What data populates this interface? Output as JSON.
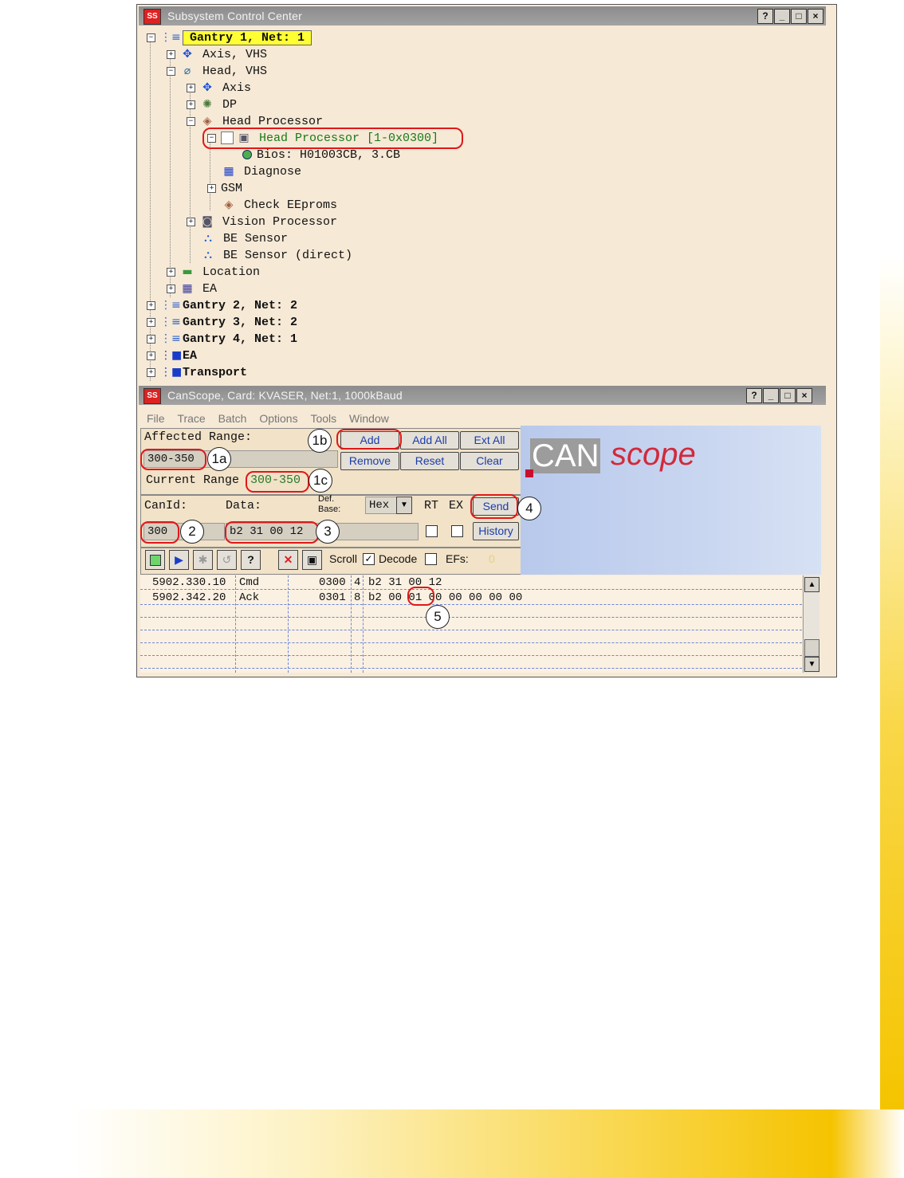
{
  "scc": {
    "title": "Subsystem Control Center",
    "tree": [
      {
        "label": "Gantry 1, Net: 1"
      },
      {
        "label": "Axis, VHS"
      },
      {
        "label": "Head, VHS"
      },
      {
        "label": "Axis"
      },
      {
        "label": "DP"
      },
      {
        "label": "Head Processor"
      },
      {
        "label": "Head Processor [1-0x0300]"
      },
      {
        "label": "Bios: H01003CB, 3.CB"
      },
      {
        "label": "Diagnose"
      },
      {
        "label": "GSM"
      },
      {
        "label": "Check EEproms"
      },
      {
        "label": "Vision Processor"
      },
      {
        "label": "BE Sensor"
      },
      {
        "label": "BE Sensor (direct)"
      },
      {
        "label": "Location"
      },
      {
        "label": "EA"
      },
      {
        "label": "Gantry 2, Net: 2"
      },
      {
        "label": "Gantry 3, Net: 2"
      },
      {
        "label": "Gantry 4, Net: 1"
      },
      {
        "label": "EA"
      },
      {
        "label": "Transport"
      }
    ]
  },
  "canscope": {
    "title": "CanScope, Card: KVASER, Net:1, 1000kBaud",
    "menu": [
      "File",
      "Trace",
      "Batch",
      "Options",
      "Tools",
      "Window"
    ],
    "affected_range_label": "Affected Range:",
    "affected_range_value": "300-350",
    "current_range_label": "Current Range",
    "current_range_value": "300-350",
    "buttons": {
      "add": "Add",
      "add_all": "Add All",
      "ext_all": "Ext All",
      "remove": "Remove",
      "reset": "Reset",
      "clear": "Clear",
      "send": "Send",
      "history": "History"
    },
    "canid_label": "CanId:",
    "data_label": "Data:",
    "def_base_label_1": "Def.",
    "def_base_label_2": "Base:",
    "base_value": "Hex",
    "rt_label": "RT",
    "ex_label": "EX",
    "canid_value": "300",
    "data_value": "b2 31 00 12",
    "scroll_label": "Scroll",
    "decode_label": "Decode",
    "efs_label": "EFs:",
    "efs_value": "0",
    "logo_can": "CAN",
    "logo_scope": "scope",
    "trace_rows": [
      {
        "time": "5902.330.10",
        "type": "Cmd",
        "id": "0300",
        "len": "4",
        "data": "b2 31 00 12",
        "data_hl": "",
        "data_rest": ""
      },
      {
        "time": "5902.342.20",
        "type": "Ack",
        "id": "0301",
        "len": "8",
        "data": "b2 00 ",
        "data_hl": "01",
        "data_rest": " 00 00 00 00 00"
      }
    ]
  },
  "callouts": {
    "c1a": "1a",
    "c1b": "1b",
    "c1c": "1c",
    "c2": "2",
    "c3": "3",
    "c4": "4",
    "c5": "5"
  }
}
